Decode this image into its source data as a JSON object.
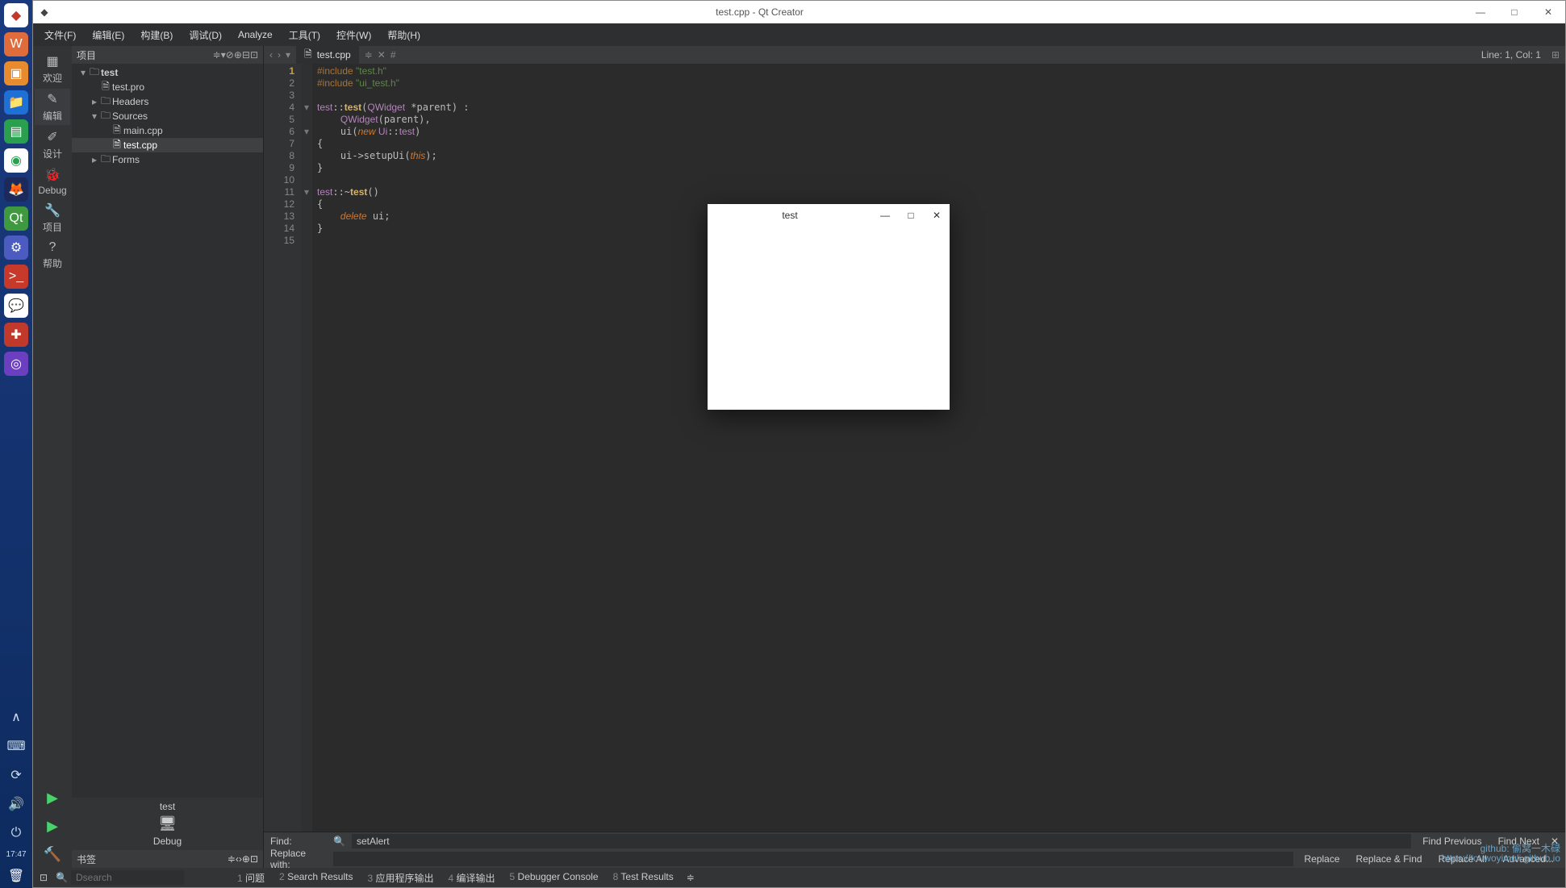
{
  "os_taskbar": {
    "items": [
      {
        "name": "start",
        "glyph": "◆",
        "bg": "#fff",
        "fg": "#c0392b"
      },
      {
        "name": "wps",
        "glyph": "W",
        "bg": "#e06c3c",
        "fg": "#fff"
      },
      {
        "name": "orange",
        "glyph": "▣",
        "bg": "#e88b2e",
        "fg": "#fff"
      },
      {
        "name": "files",
        "glyph": "📁",
        "bg": "#1e6fd6",
        "fg": "#fff"
      },
      {
        "name": "green",
        "glyph": "▤",
        "bg": "#2aa04f",
        "fg": "#fff"
      },
      {
        "name": "chrome",
        "glyph": "◉",
        "bg": "#fff",
        "fg": "#2aa04f"
      },
      {
        "name": "firefox",
        "glyph": "🦊",
        "bg": "#1b2a5b",
        "fg": "#ff7b29"
      },
      {
        "name": "qt",
        "glyph": "Qt",
        "bg": "#3f9a3f",
        "fg": "#fff"
      },
      {
        "name": "settings",
        "glyph": "⚙",
        "bg": "#4b5bbf",
        "fg": "#fff"
      },
      {
        "name": "terminal",
        "glyph": ">_",
        "bg": "#c7392a",
        "fg": "#fff"
      },
      {
        "name": "wechat",
        "glyph": "💬",
        "bg": "#fff",
        "fg": "#3aa03a"
      },
      {
        "name": "red",
        "glyph": "✚",
        "bg": "#c0392b",
        "fg": "#fff"
      },
      {
        "name": "purple",
        "glyph": "◎",
        "bg": "#6b3fbf",
        "fg": "#fff"
      }
    ],
    "tray": [
      {
        "name": "up",
        "glyph": "∧"
      },
      {
        "name": "keyboard",
        "glyph": "⌨"
      },
      {
        "name": "refresh",
        "glyph": "⟳"
      },
      {
        "name": "volume",
        "glyph": "🔊"
      },
      {
        "name": "power",
        "glyph": "⏻"
      }
    ],
    "time": "17:47",
    "trash": "🗑"
  },
  "titlebar": {
    "title": "test.cpp - Qt Creator",
    "min": "—",
    "max": "□",
    "close": "✕"
  },
  "menus": [
    "文件(F)",
    "编辑(E)",
    "构建(B)",
    "调试(D)",
    "Analyze",
    "工具(T)",
    "控件(W)",
    "帮助(H)"
  ],
  "modes": [
    {
      "icon": "▦",
      "label": "欢迎"
    },
    {
      "icon": "✎",
      "label": "编辑",
      "sel": true
    },
    {
      "icon": "✐",
      "label": "设计"
    },
    {
      "icon": "🐞",
      "label": "Debug"
    },
    {
      "icon": "🔧",
      "label": "项目"
    },
    {
      "icon": "?",
      "label": "帮助"
    }
  ],
  "run_target": {
    "project": "test",
    "icon": "🖥",
    "kit": "Debug"
  },
  "project_panel": {
    "title": "项目",
    "buttons": [
      "≑",
      "▾",
      "⊘",
      "⊕",
      "⊟",
      "⊡"
    ]
  },
  "tree": [
    {
      "depth": 0,
      "arrow": "▾",
      "icon": "🗀",
      "label": "test",
      "bold": true
    },
    {
      "depth": 1,
      "arrow": "",
      "icon": "🗎",
      "label": "test.pro"
    },
    {
      "depth": 1,
      "arrow": "▸",
      "icon": "🗀",
      "label": "Headers"
    },
    {
      "depth": 1,
      "arrow": "▾",
      "icon": "🗀",
      "label": "Sources"
    },
    {
      "depth": 2,
      "arrow": "",
      "icon": "🗎",
      "label": "main.cpp"
    },
    {
      "depth": 2,
      "arrow": "",
      "icon": "🗎",
      "label": "test.cpp",
      "sel": true
    },
    {
      "depth": 1,
      "arrow": "▸",
      "icon": "🗀",
      "label": "Forms"
    }
  ],
  "bookmarks": {
    "title": "书签",
    "buttons": [
      "≑",
      "‹",
      "›",
      "⊕",
      "⊡"
    ]
  },
  "editor": {
    "nav": [
      "‹",
      "›",
      "▾"
    ],
    "tab_icon": "🗎",
    "tab_label": "test.cpp",
    "tab_buttons": [
      "≑",
      "✕",
      "#"
    ],
    "position": "Line: 1, Col: 1",
    "split": "⊞",
    "lines": [
      1,
      2,
      3,
      4,
      5,
      6,
      7,
      8,
      9,
      10,
      11,
      12,
      13,
      14,
      15
    ],
    "highlight_line": 1,
    "fold": {
      "4": "▾",
      "6": "▾",
      "11": "▾"
    },
    "code": {
      "l1": {
        "pp": "#include ",
        "str": "\"test.h\""
      },
      "l2": {
        "pp": "#include ",
        "str": "\"ui_test.h\""
      },
      "l4": {
        "a": "test",
        "b": "::",
        "c": "test",
        "d": "(",
        "e": "QWidget",
        "f": " *parent) :"
      },
      "l5": {
        "a": "    ",
        "b": "QWidget",
        "c": "(parent),"
      },
      "l6": {
        "a": "    ui(",
        "b": "new",
        "c": " Ui",
        "d": "::",
        "e": "test",
        "f": ")"
      },
      "l7": "{",
      "l8": {
        "a": "    ui->setupUi(",
        "b": "this",
        "c": ");"
      },
      "l9": "}",
      "l11": {
        "a": "test",
        "b": "::~",
        "c": "test",
        "d": "()"
      },
      "l12": "{",
      "l13": {
        "a": "    ",
        "b": "delete",
        "c": " ui;"
      },
      "l14": "}"
    }
  },
  "find": {
    "find_label": "Find:",
    "replace_label": "Replace with:",
    "search_icon": "🔍",
    "value": "setAlert",
    "btns": [
      "Find Previous",
      "Find Next",
      "Replace",
      "Replace & Find",
      "Replace All",
      "Advanced..."
    ],
    "close": "✕"
  },
  "statusbar": {
    "left_icon": "⊡",
    "search_icon": "🔍",
    "search_placeholder": "Dsearch",
    "tabs": [
      {
        "n": "1",
        "l": "问题"
      },
      {
        "n": "2",
        "l": "Search Results"
      },
      {
        "n": "3",
        "l": "应用程序输出"
      },
      {
        "n": "4",
        "l": "编译输出"
      },
      {
        "n": "5",
        "l": "Debugger Console"
      },
      {
        "n": "8",
        "l": "Test Results"
      }
    ],
    "more": "≑"
  },
  "credits": {
    "l1": "github: 偷窝一木碌",
    "l2": "https://touwoyimuli.github.io"
  },
  "popup": {
    "title": "test",
    "min": "—",
    "max": "□",
    "close": "✕"
  }
}
